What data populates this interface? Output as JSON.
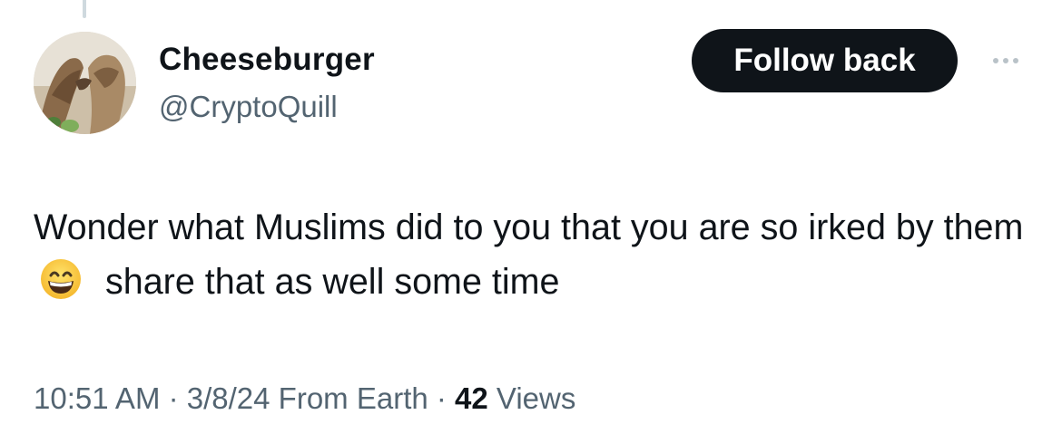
{
  "profile": {
    "display_name": "Cheeseburger",
    "handle": "@CryptoQuill"
  },
  "actions": {
    "follow_label": "Follow back",
    "more_icon": "more-horizontal-icon"
  },
  "tweet": {
    "text_part1": "Wonder what Muslims did to you that you are so irked by them",
    "emoji": "grinning-face-with-smiling-eyes",
    "text_part2": "share that as well some time"
  },
  "meta": {
    "time": "10:51 AM",
    "sep1": " · ",
    "date": "3/8/24",
    "source": " From Earth",
    "sep2": " · ",
    "views_count": "42",
    "views_label": " Views"
  },
  "colors": {
    "text_primary": "#0f1419",
    "text_secondary": "#536471",
    "button_bg": "#0f1419",
    "button_text": "#ffffff",
    "thread_line": "#cfd9de"
  }
}
